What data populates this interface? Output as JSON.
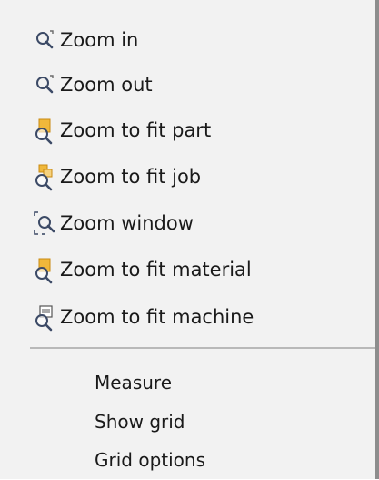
{
  "menu": {
    "items": [
      {
        "label": "Zoom in",
        "icon": "zoom-in-icon"
      },
      {
        "label": "Zoom out",
        "icon": "zoom-out-icon"
      },
      {
        "label": "Zoom to fit part",
        "icon": "zoom-fit-part-icon"
      },
      {
        "label": "Zoom to fit job",
        "icon": "zoom-fit-job-icon"
      },
      {
        "label": "Zoom window",
        "icon": "zoom-window-icon"
      },
      {
        "label": "Zoom to fit material",
        "icon": "zoom-fit-material-icon"
      },
      {
        "label": "Zoom to fit machine",
        "icon": "zoom-fit-machine-icon"
      }
    ],
    "plain_items": [
      {
        "label": "Measure"
      },
      {
        "label": "Show grid"
      },
      {
        "label": "Grid options"
      }
    ]
  },
  "colors": {
    "background": "#f2f2f2",
    "text": "#1a1a1a",
    "separator": "#b9b9b9",
    "icon_accent": "#f0b83b",
    "icon_stroke": "#3c4a66"
  }
}
